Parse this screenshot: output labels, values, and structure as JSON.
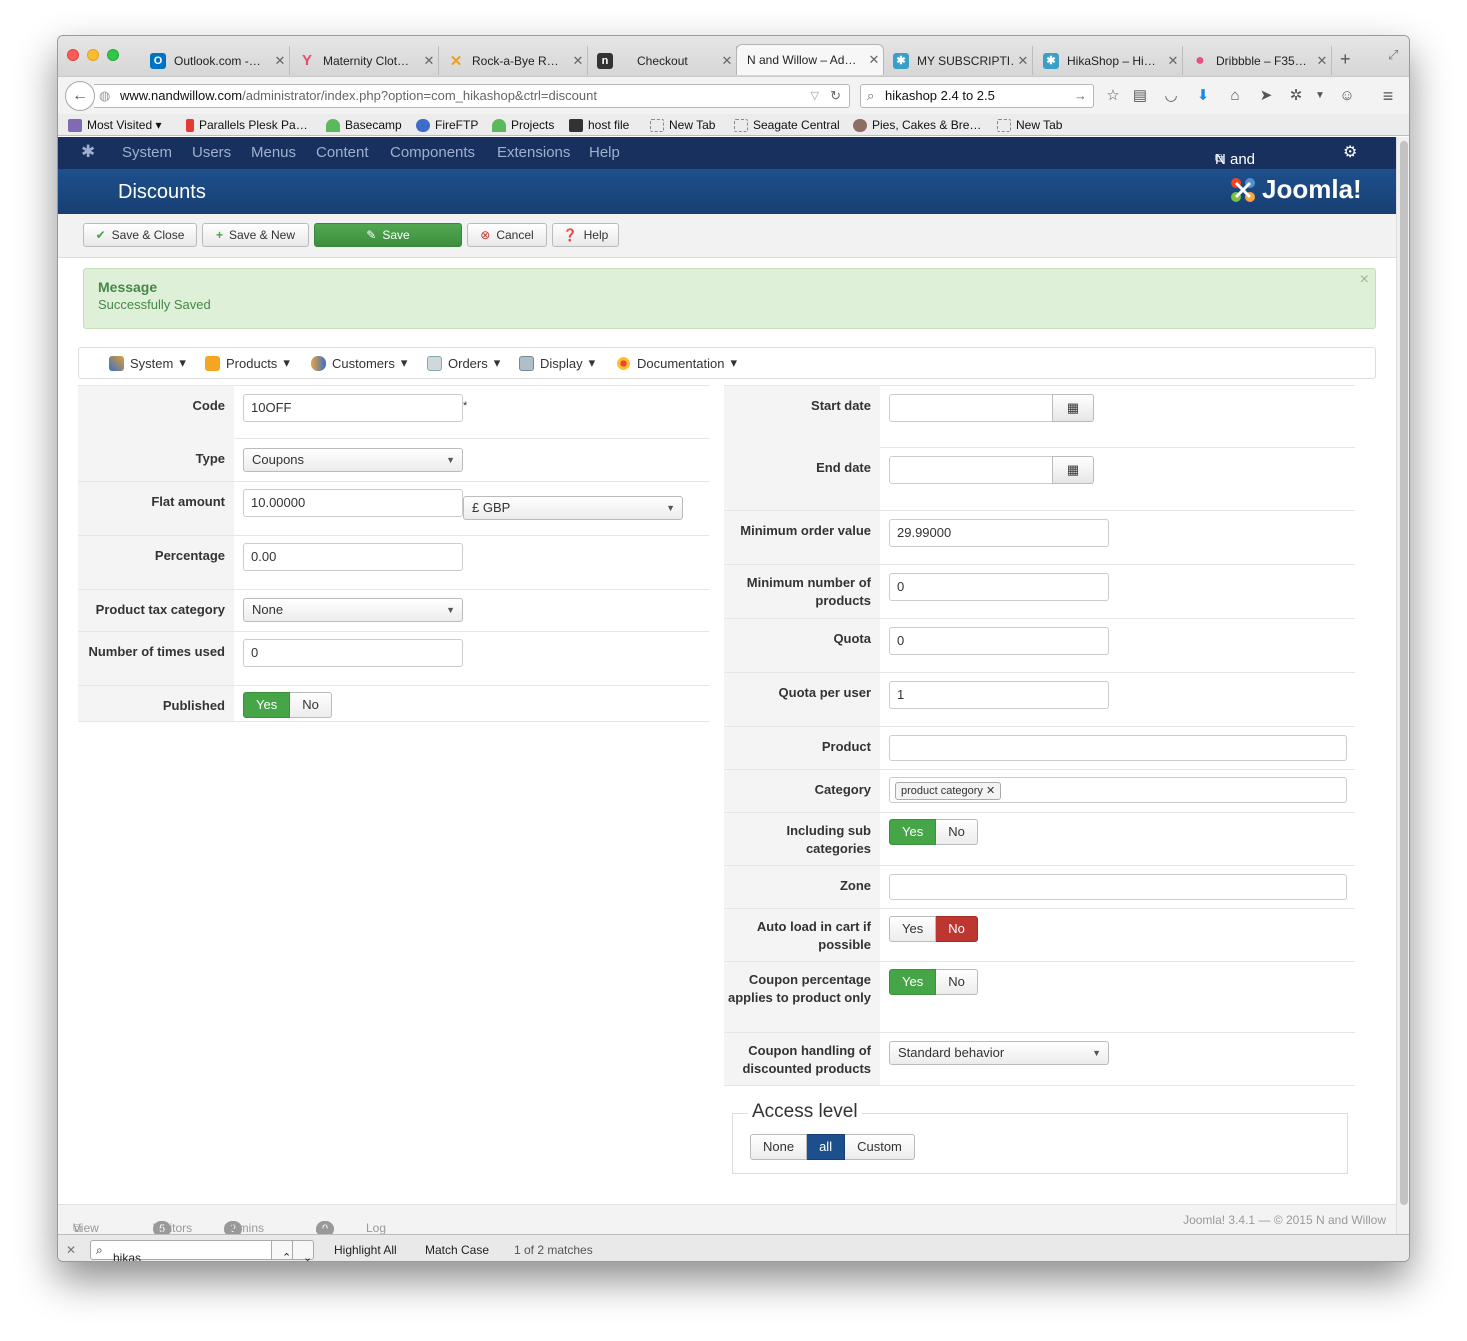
{
  "browser": {
    "tabs": [
      {
        "title": "Outlook.com -…",
        "color": "#0072c6",
        "glyph": "O"
      },
      {
        "title": "Maternity Clot…",
        "color": "#e84c6c",
        "glyph": "Y"
      },
      {
        "title": "Rock-a-Bye R…",
        "color": "#f29d1b",
        "glyph": "✕"
      },
      {
        "title": "Checkout",
        "color": "#333333",
        "glyph": "n"
      },
      {
        "title": "N and Willow – Ad…",
        "color": "",
        "glyph": ""
      },
      {
        "title": "MY SUBSCRIPTI…",
        "color": "#3ba0c8",
        "glyph": "✱"
      },
      {
        "title": "HikaShop – Hi…",
        "color": "#3ba0c8",
        "glyph": "✱"
      },
      {
        "title": "Dribbble – F35…",
        "color": "#ea4c89",
        "glyph": "●"
      }
    ],
    "url_host": "www.nandwillow.com",
    "url_path": "/administrator/index.php?option=com_hikashop&ctrl=discount",
    "search_value": "hikashop 2.4 to 2.5",
    "bookmarks": [
      "Most Visited",
      "Parallels Plesk Pa…",
      "Basecamp",
      "FireFTP",
      "Projects",
      "host file",
      "New Tab",
      "Seagate Central",
      "Pies, Cakes & Bre…",
      "New Tab"
    ]
  },
  "joomla": {
    "menu": [
      "System",
      "Users",
      "Menus",
      "Content",
      "Components",
      "Extensions",
      "Help"
    ],
    "site_name": "N and Willow",
    "page_title": "Discounts",
    "logo_text": "Joomla!",
    "toolbar": {
      "save_close": "Save & Close",
      "save_new": "Save & New",
      "save": "Save",
      "cancel": "Cancel",
      "help": "Help"
    },
    "message": {
      "heading": "Message",
      "text": "Successfully Saved"
    }
  },
  "hikashop_menu": [
    "System",
    "Products",
    "Customers",
    "Orders",
    "Display",
    "Documentation"
  ],
  "form_left": {
    "code_label": "Code",
    "code_value": "10OFF",
    "required_mark": "*",
    "type_label": "Type",
    "type_value": "Coupons",
    "flat_label": "Flat amount",
    "flat_value": "10.00000",
    "currency": "£ GBP",
    "percentage_label": "Percentage",
    "percentage_value": "0.00",
    "taxcat_label": "Product tax category",
    "taxcat_value": "None",
    "used_label": "Number of times used",
    "used_value": "0",
    "published_label": "Published",
    "yes": "Yes",
    "no": "No"
  },
  "form_right": {
    "start_label": "Start date",
    "start_value": "",
    "end_label": "End date",
    "end_value": "",
    "minorder_label": "Minimum order value",
    "minorder_value": "29.99000",
    "minproducts_label": "Minimum number of products",
    "minproducts_value": "0",
    "quota_label": "Quota",
    "quota_value": "0",
    "quotauser_label": "Quota per user",
    "quotauser_value": "1",
    "product_label": "Product",
    "product_value": "",
    "category_label": "Category",
    "category_chip": "product category",
    "subcat_label": "Including sub categories",
    "zone_label": "Zone",
    "zone_value": "",
    "autoload_label": "Auto load in cart if possible",
    "couponpct_label": "Coupon percentage applies to product only",
    "handling_label": "Coupon handling of discounted products",
    "handling_value": "Standard behavior",
    "yes": "Yes",
    "no": "No"
  },
  "access": {
    "legend": "Access level",
    "none": "None",
    "all": "all",
    "custom": "Custom"
  },
  "footer": {
    "view_site": "View Site",
    "visitors_count": "5",
    "visitors": "Visitors",
    "admins_count": "2",
    "admins": "Admins",
    "messages_count": "0",
    "logout": "Log out",
    "version": "Joomla! 3.4.1  —  © 2015 N and Willow"
  },
  "findbar": {
    "query": "hikas",
    "highlight": "Highlight All",
    "match_case": "Match Case",
    "matches": "1 of 2 matches"
  }
}
